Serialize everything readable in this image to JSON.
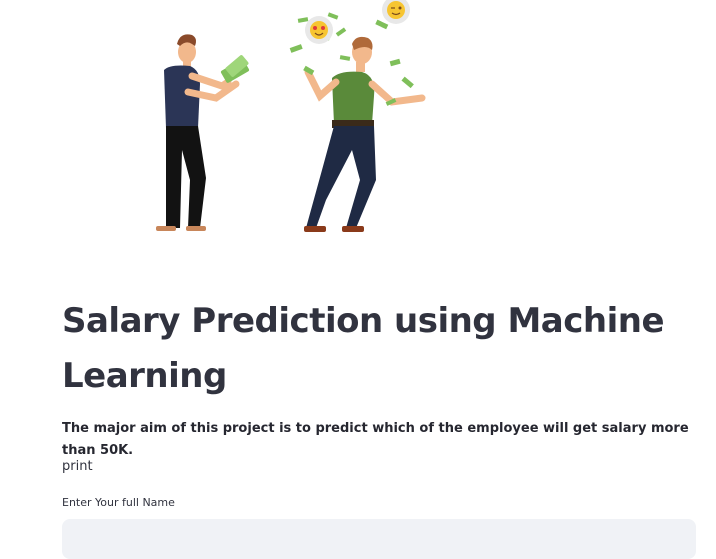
{
  "page": {
    "illustration_description_icon": "two-men-money-illustration",
    "title": "Salary Prediction using Machine Learning",
    "subtitle": "The major aim of this project is to predict which of the employee will get salary more than 50K.",
    "print_text": "print"
  },
  "form": {
    "name_label": "Enter Your full Name",
    "name_value": "",
    "name_placeholder": ""
  },
  "colors": {
    "text": "#31333f",
    "input_bg": "#f0f2f6",
    "money_green": "#7fbf5a"
  }
}
